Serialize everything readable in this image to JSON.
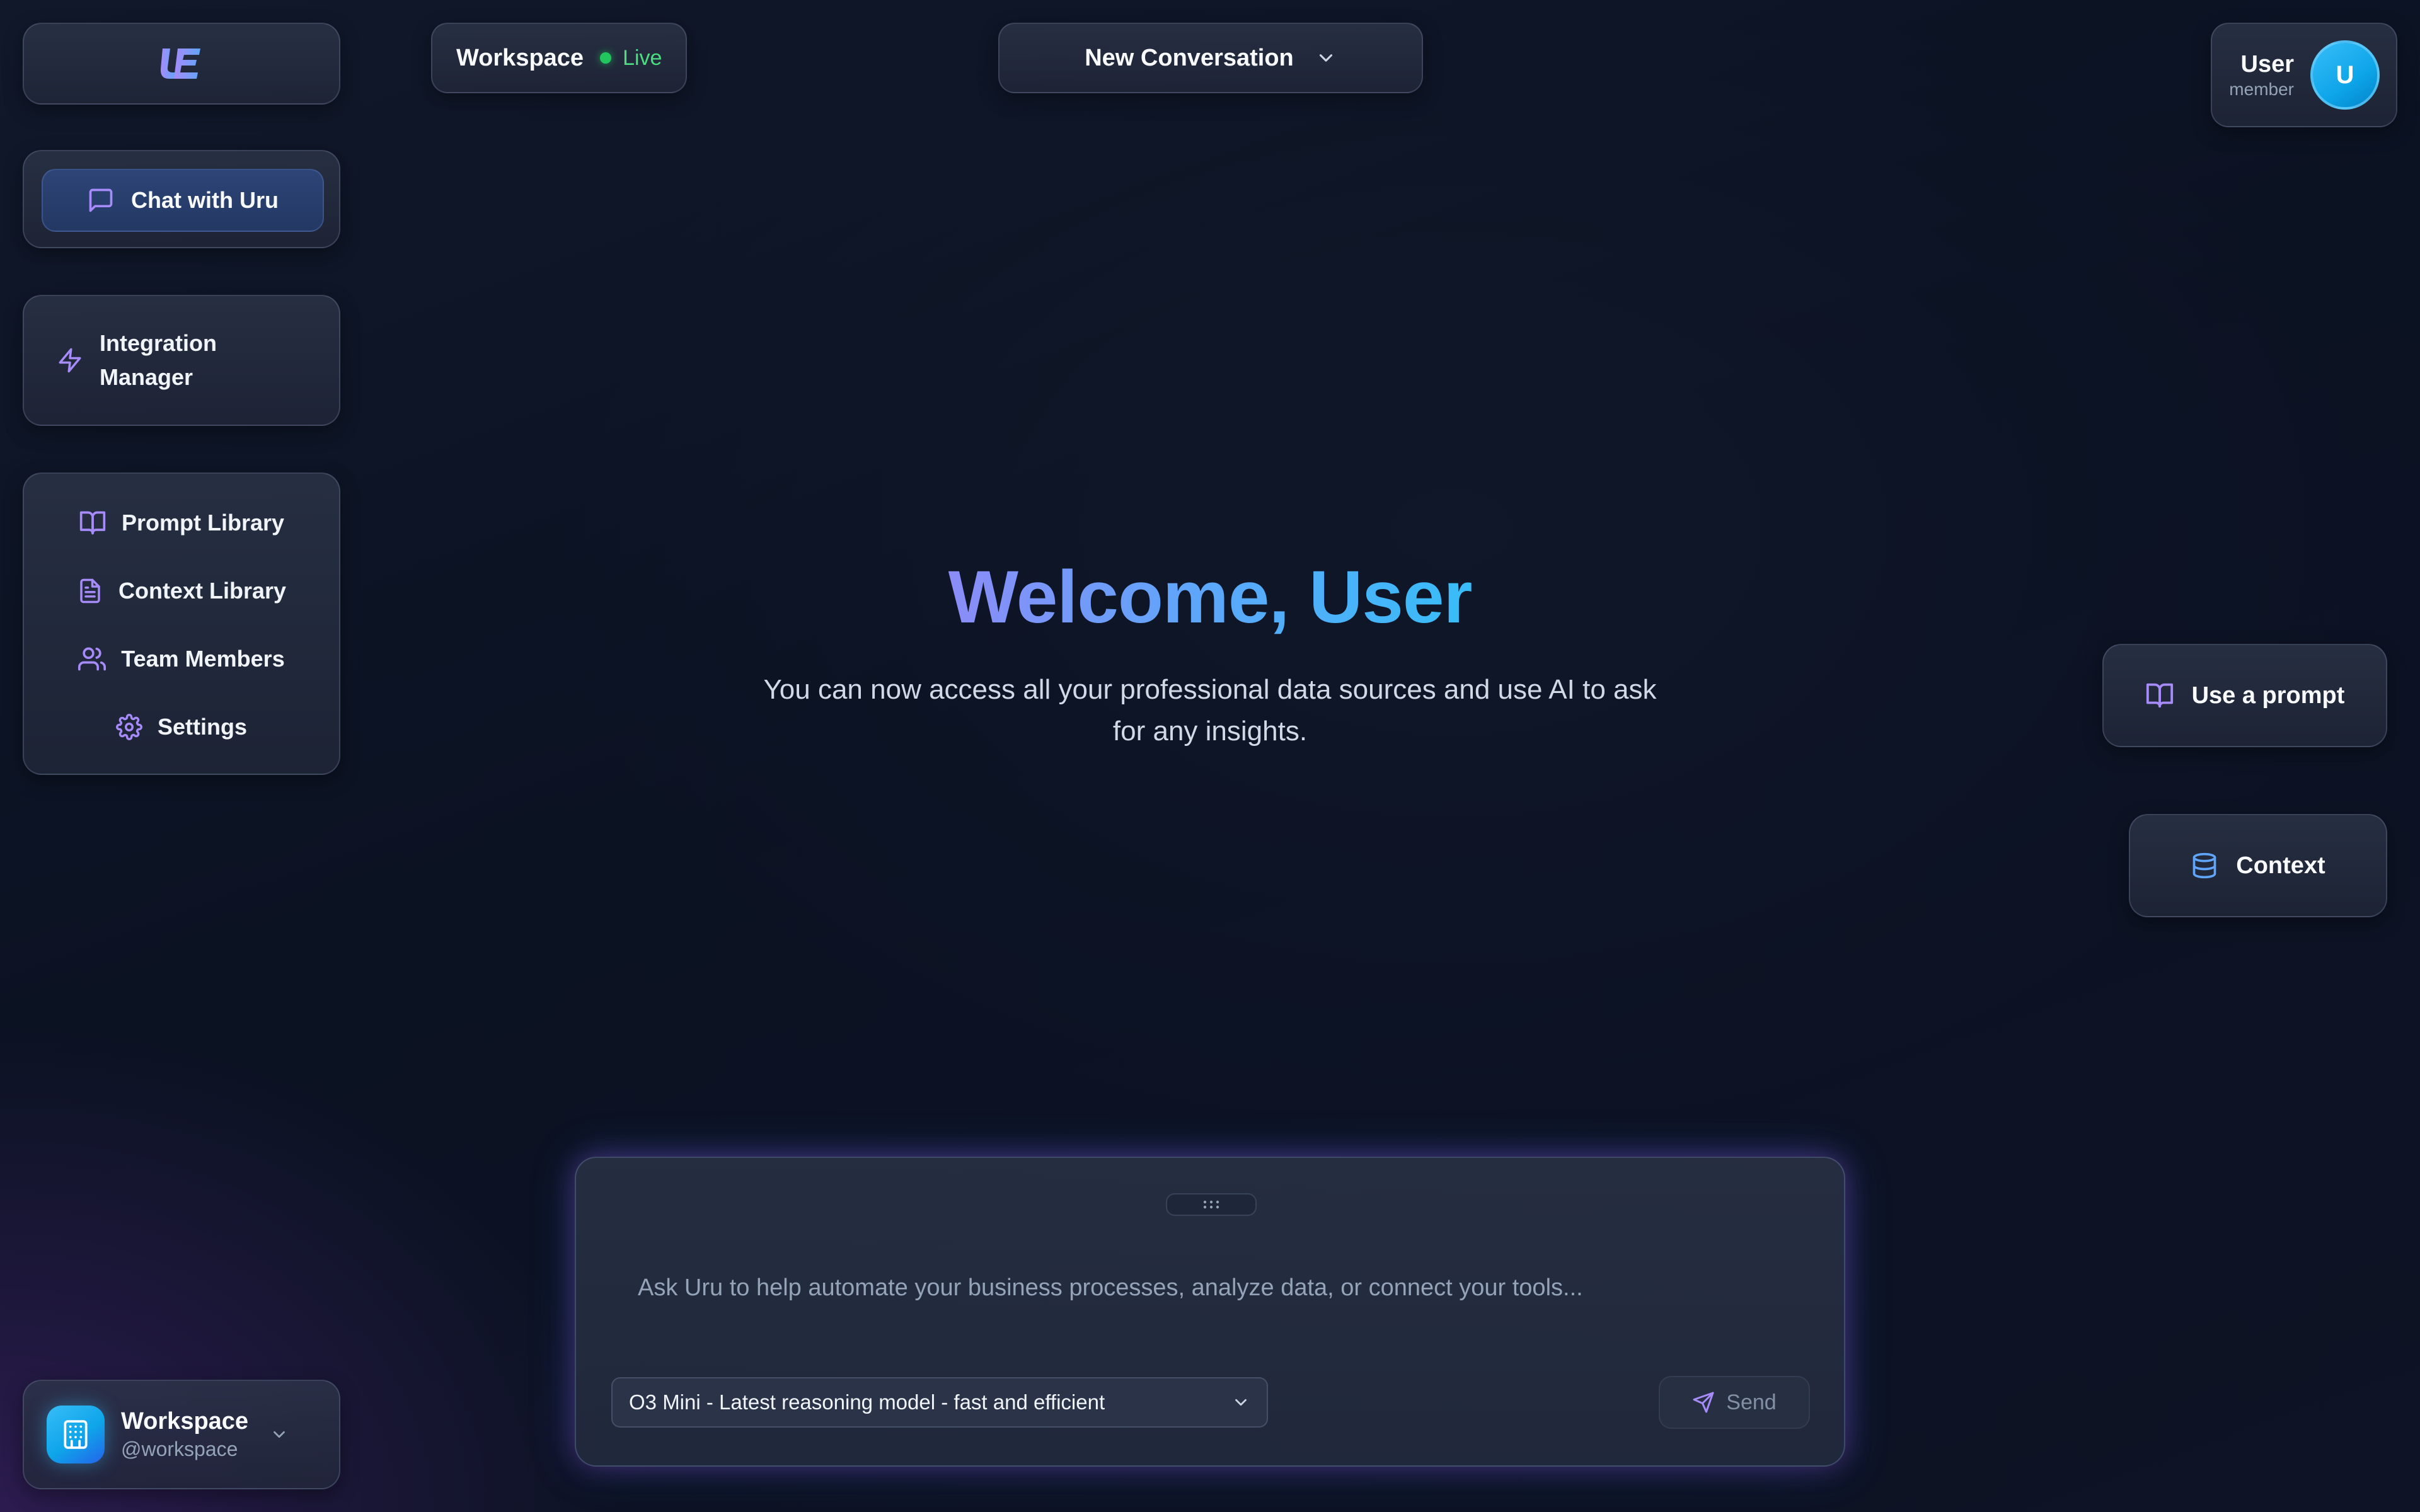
{
  "sidebar": {
    "logo_icon": "uru-logo-icon",
    "chat_button": {
      "label": "Chat with Uru",
      "icon": "message-square-icon"
    },
    "integration_button": {
      "label_line1": "Integration",
      "label_line2": "Manager",
      "icon": "zap-icon"
    },
    "nav_items": [
      {
        "label": "Prompt Library",
        "icon": "book-open-icon"
      },
      {
        "label": "Context Library",
        "icon": "file-text-icon"
      },
      {
        "label": "Team Members",
        "icon": "users-icon"
      },
      {
        "label": "Settings",
        "icon": "gear-icon"
      }
    ],
    "workspace_switcher": {
      "name": "Workspace",
      "handle": "@workspace",
      "icon": "building-icon"
    }
  },
  "header": {
    "workspace_pill": {
      "title": "Workspace",
      "status": "Live",
      "status_color": "#22c55e"
    },
    "conversation_dropdown": {
      "label": "New Conversation",
      "icon": "chevron-down-icon"
    },
    "user": {
      "name": "User",
      "role": "member",
      "avatar_initial": "U"
    }
  },
  "main": {
    "welcome": "Welcome, User",
    "subtitle": "You can now access all your professional data sources and use AI to ask for any insights."
  },
  "side_actions": {
    "use_prompt": {
      "label": "Use a prompt",
      "icon": "book-open-icon"
    },
    "context": {
      "label": "Context",
      "icon": "database-icon"
    }
  },
  "composer": {
    "placeholder": "Ask Uru to help automate your business processes, analyze data, or connect your tools...",
    "value": "",
    "model_selected": "O3 Mini - Latest reasoning model - fast and efficient",
    "send_label": "Send"
  },
  "colors": {
    "accent_purple": "#a78bfa",
    "accent_blue": "#38bdf8",
    "live_green": "#22c55e",
    "background": "#0f1729"
  }
}
